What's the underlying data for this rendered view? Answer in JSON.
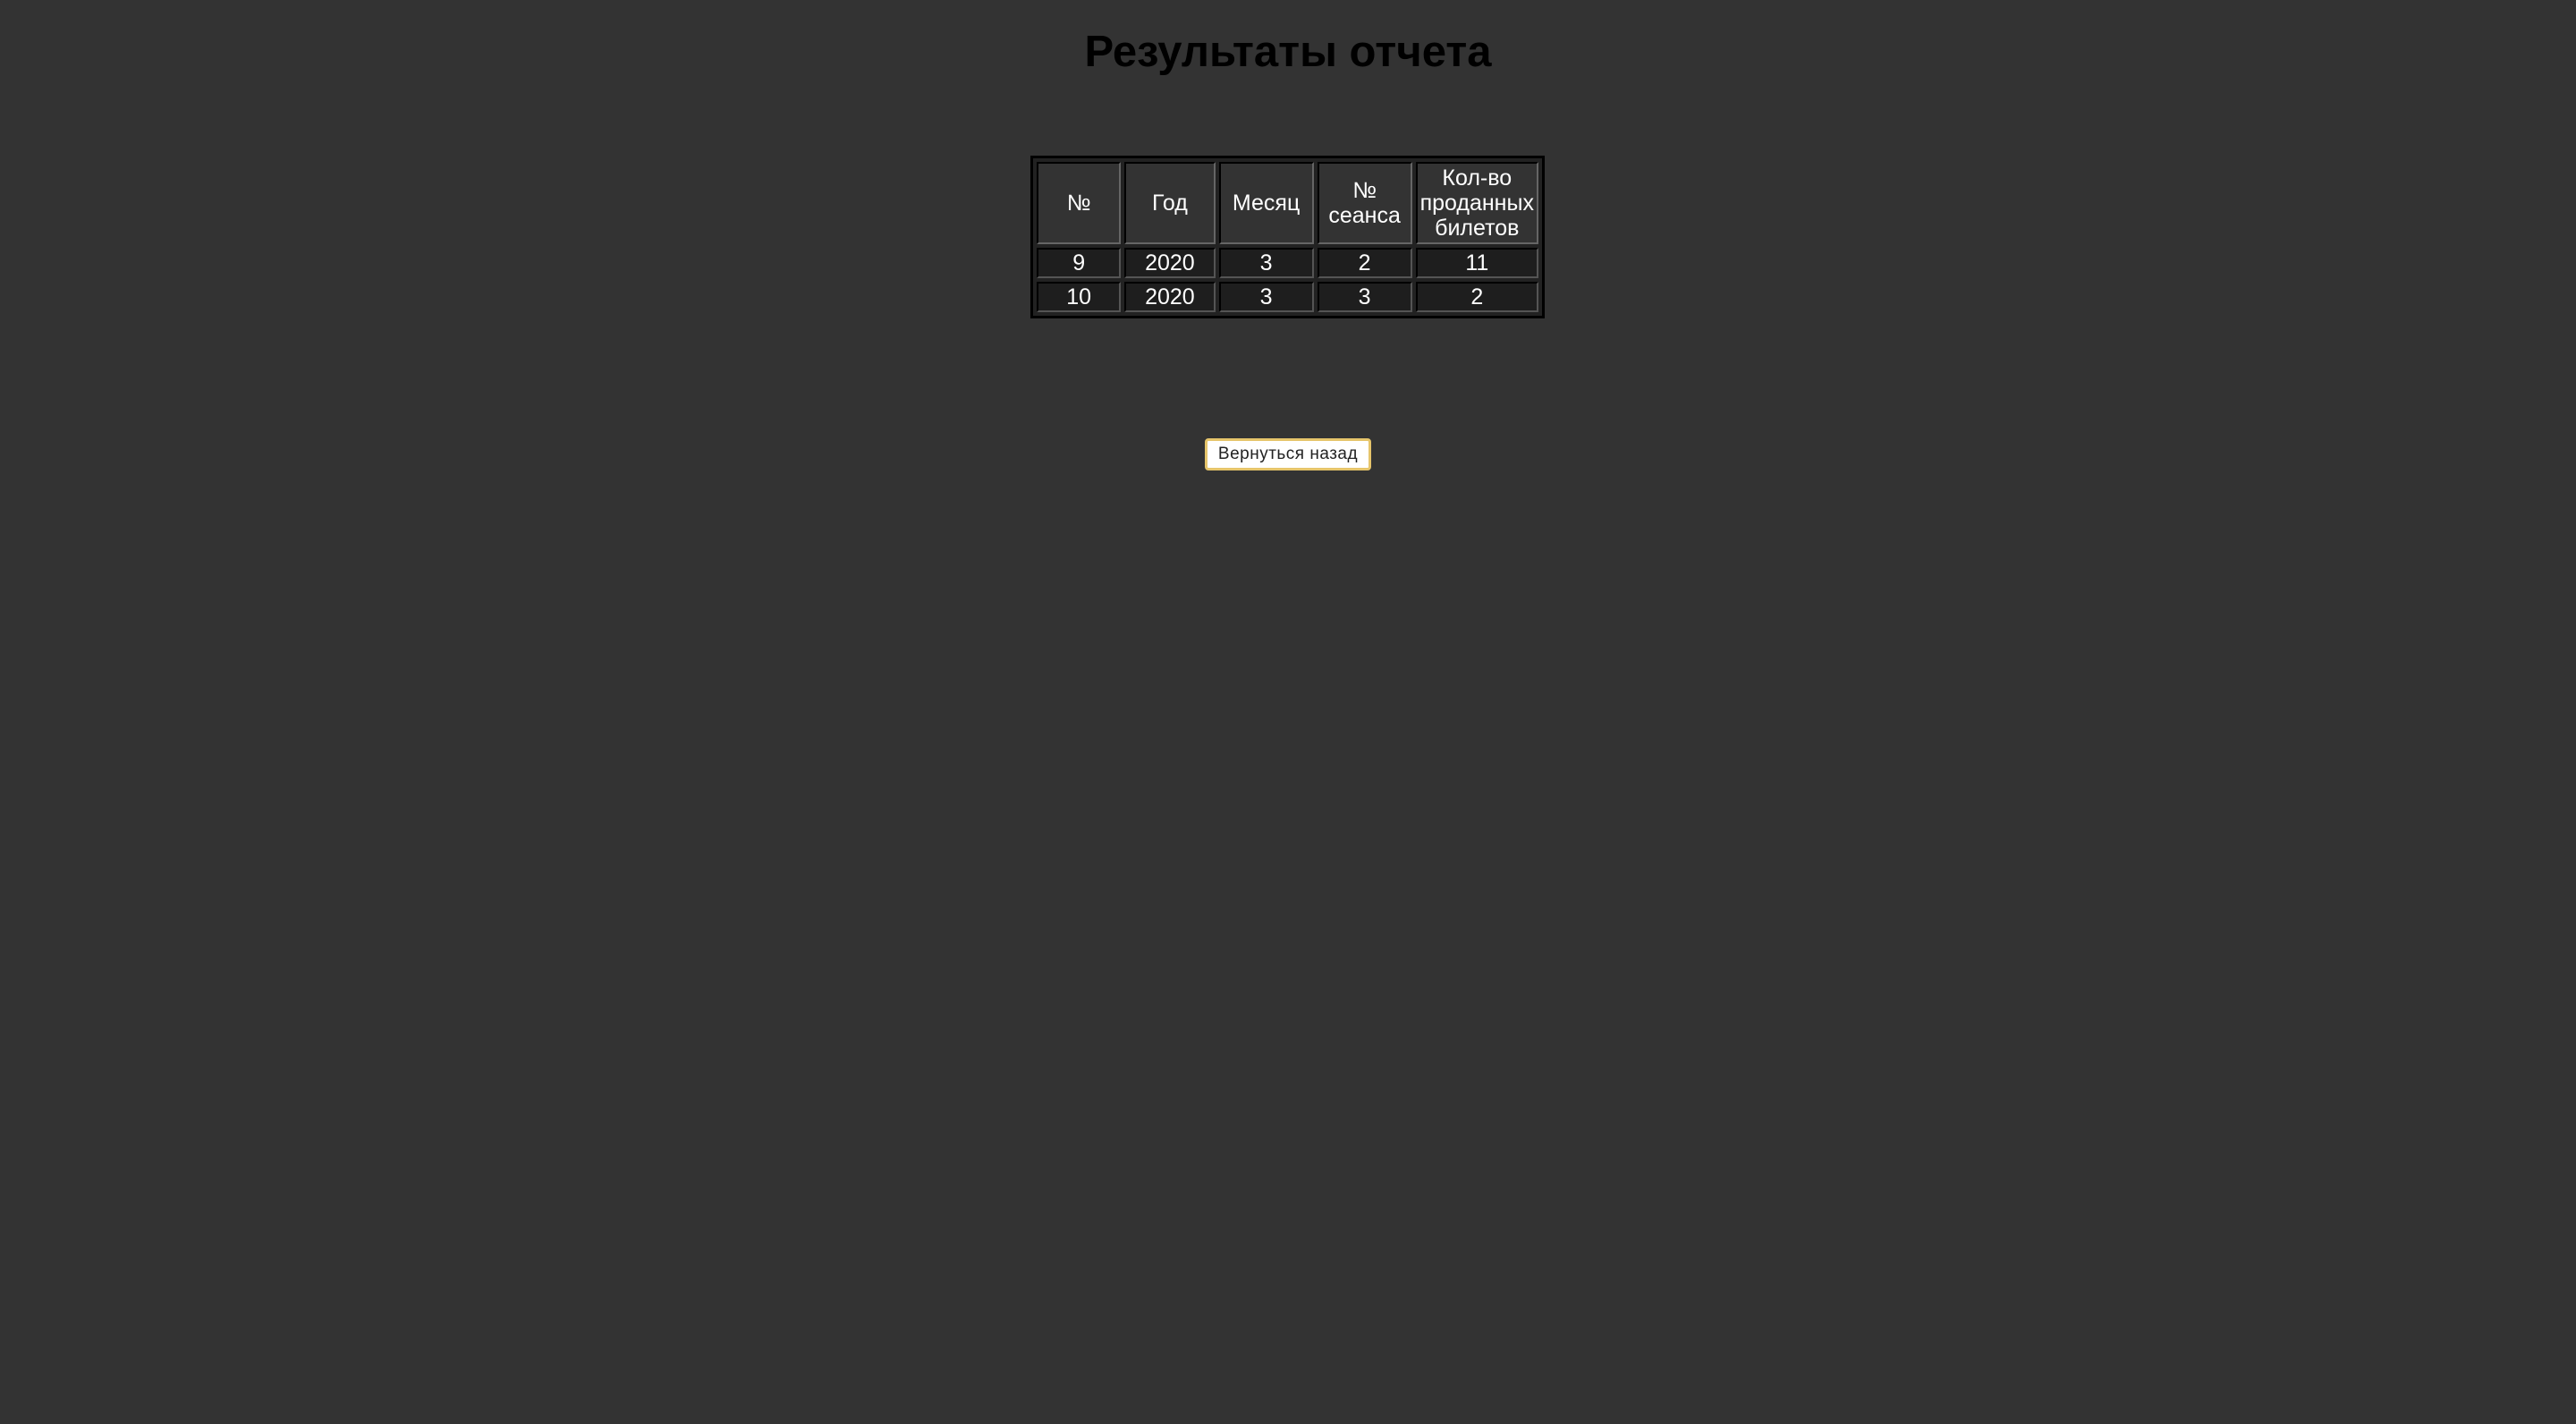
{
  "page": {
    "title": "Результаты отчета"
  },
  "table": {
    "headers": [
      "№",
      "Год",
      "Месяц",
      "№ сеанса",
      "Кол-во проданных билетов"
    ],
    "rows": [
      [
        "9",
        "2020",
        "3",
        "2",
        "11"
      ],
      [
        "10",
        "2020",
        "3",
        "3",
        "2"
      ]
    ]
  },
  "actions": {
    "back_label": "Вернуться назад"
  }
}
